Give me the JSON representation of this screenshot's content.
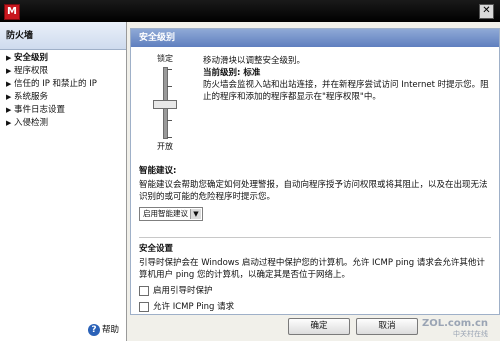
{
  "window": {
    "logo": "M",
    "close": "✕"
  },
  "sidebar": {
    "title": "防火墙",
    "items": [
      {
        "label": "安全级别",
        "active": true
      },
      {
        "label": "程序权限"
      },
      {
        "label": "信任的 IP 和禁止的 IP"
      },
      {
        "label": "系统服务"
      },
      {
        "label": "事件日志设置"
      },
      {
        "label": "入侵检测"
      }
    ],
    "help_label": "帮助"
  },
  "main": {
    "header": "安全级别",
    "slider": {
      "top_label": "锁定",
      "bottom_label": "开放",
      "level": "标准"
    },
    "description": {
      "line1": "移动滑块以调整安全级别。",
      "current_label": "当前级别: 标准",
      "body": "防火墙会监视入站和出站连接，并在新程序尝试访问 Internet 时提示您。阻止的程序和添加的程序都显示在\"程序权限\"中。"
    },
    "smart": {
      "title": "智能建议:",
      "body": "智能建议会帮助您确定如何处理警报，自动向程序授予访问权限或将其阻止，以及在出现无法识别的或可能的危险程序时提示您。",
      "select_value": "启用智能建议"
    },
    "security": {
      "title": "安全设置",
      "body": "引导时保护会在 Windows 启动过程中保护您的计算机。允许 ICMP ping 请求会允许其他计算机用户 ping 您的计算机，以确定其是否位于网络上。",
      "check1": "启用引导时保护",
      "check2": "允许 ICMP Ping 请求"
    }
  },
  "footer": {
    "ok": "确定",
    "cancel": "取消"
  },
  "watermark": {
    "brand": "ZOL.com.cn",
    "sub": "中关村在线"
  },
  "colors": {
    "accent": "#6f8ec9",
    "brand_red": "#c8171e"
  }
}
